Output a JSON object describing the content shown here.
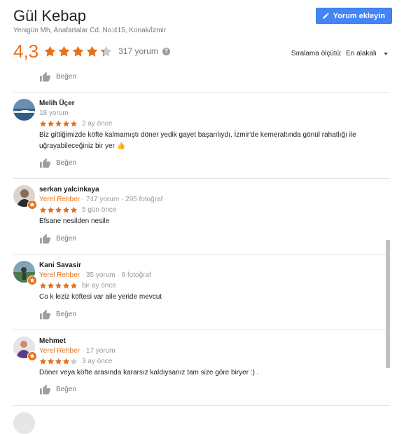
{
  "place": {
    "name": "Gül Kebap",
    "address": "Yenigün Mh, Anafartalar Cd. No:415, Konak/İzmir",
    "rating": "4,3",
    "rating_value": 4.3,
    "review_count": "317 yorum"
  },
  "add_review_label": "Yorum ekleyin",
  "sort": {
    "label": "Sıralama ölçütü:",
    "value": "En alakalı"
  },
  "like_label": "Beğen",
  "colors": {
    "star": "#e7711b",
    "button": "#4285f4"
  },
  "reviews": [
    {
      "name": "Melih Üçer",
      "meta": "18 yorum",
      "local_guide": false,
      "stars": 5,
      "ago": "2 ay önce",
      "text": "Biz gittiğimizde köfte kalmamıştı döner yedik gayet başarılıydı, İzmir'de kemeraltında gönül rahatlığı ile uğrayabileceğiniz bir yer 👍",
      "like": "Beğen"
    },
    {
      "name": "serkan yalcinkaya",
      "guide": "Yerel Rehber",
      "meta": " · 747 yorum · 295 fotoğraf",
      "local_guide": true,
      "stars": 5,
      "ago": "5 gün önce",
      "text": "Efsane nesilden nesile",
      "like": "Beğen"
    },
    {
      "name": "Kani Savasir",
      "guide": "Yerel Rehber",
      "meta": " · 35 yorum · 6 fotoğraf",
      "local_guide": true,
      "stars": 5,
      "ago": "bir ay önce",
      "text": "Co k leziz köftesi var aile yeride mevcut",
      "like": "Beğen"
    },
    {
      "name": "Mehmet",
      "guide": "Yerel Rehber",
      "meta": " · 17 yorum",
      "local_guide": true,
      "stars": 4,
      "ago": "3 ay önce",
      "text": "Döner veya köfte arasında kararsız kaldıysanız tam size göre biryer :) .",
      "like": "Beğen"
    }
  ]
}
